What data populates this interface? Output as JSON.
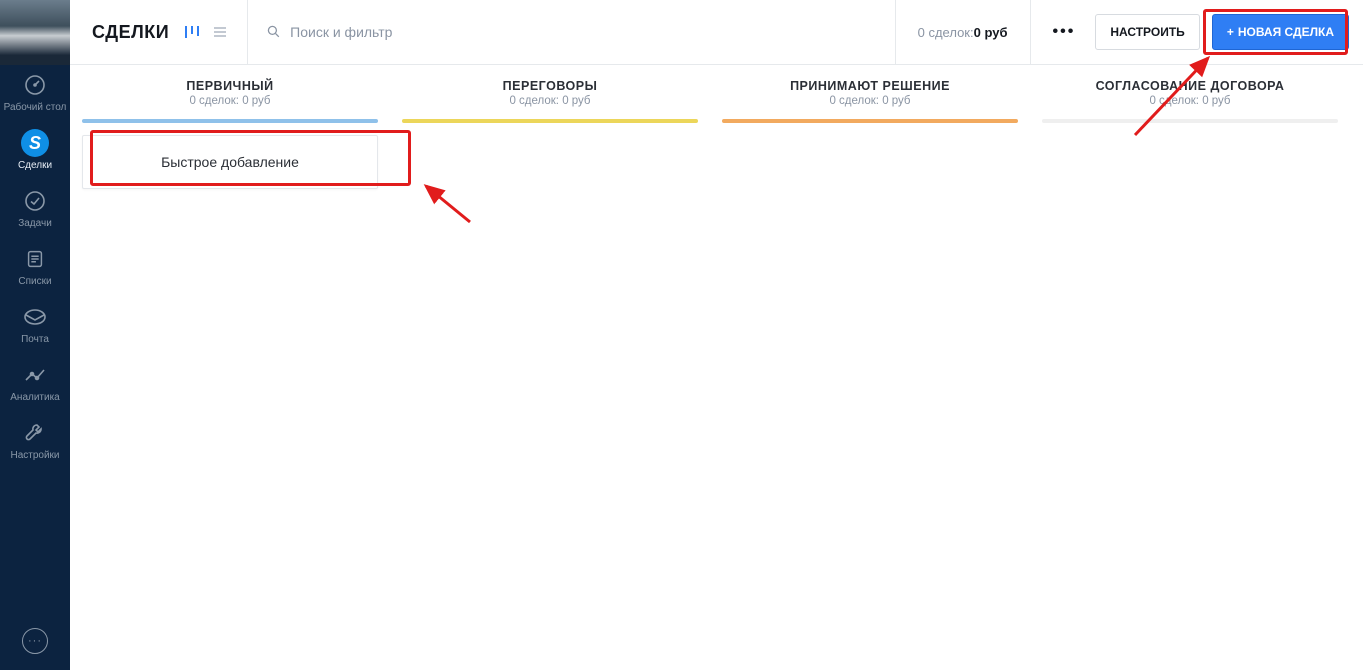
{
  "sidebar": {
    "items": [
      {
        "label": "Рабочий стол"
      },
      {
        "label": "Сделки"
      },
      {
        "label": "Задачи"
      },
      {
        "label": "Списки"
      },
      {
        "label": "Почта"
      },
      {
        "label": "Аналитика"
      },
      {
        "label": "Настройки"
      }
    ]
  },
  "header": {
    "title": "СДЕЛКИ",
    "search_placeholder": "Поиск и фильтр",
    "summary_prefix": "0 сделок: ",
    "summary_amount": "0 руб",
    "configure_label": "НАСТРОИТЬ",
    "new_deal_label": "НОВАЯ СДЕЛКА"
  },
  "pipeline": {
    "quick_add_label": "Быстрое добавление",
    "stages": [
      {
        "name": "ПЕРВИЧНЫЙ",
        "meta": "0 сделок: 0 руб",
        "color": "#8fc1ea"
      },
      {
        "name": "ПЕРЕГОВОРЫ",
        "meta": "0 сделок: 0 руб",
        "color": "#ecd65a"
      },
      {
        "name": "ПРИНИМАЮТ РЕШЕНИЕ",
        "meta": "0 сделок: 0 руб",
        "color": "#f2aa5f"
      },
      {
        "name": "СОГЛАСОВАНИЕ ДОГОВОРА",
        "meta": "0 сделок: 0 руб",
        "color": "#efefef"
      }
    ]
  }
}
